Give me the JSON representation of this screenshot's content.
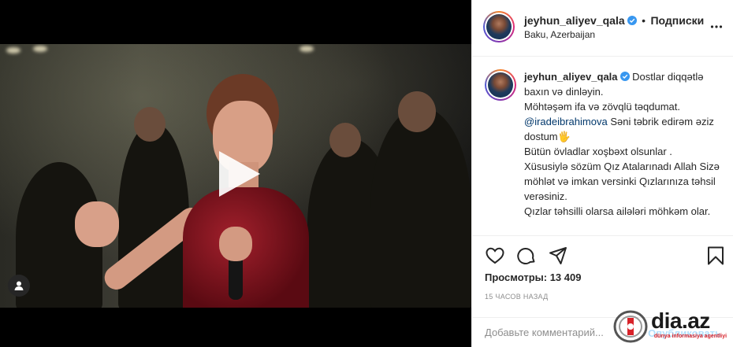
{
  "post": {
    "username": "jeyhun_aliyev_qala",
    "separator": "•",
    "follow_label": "Подписки",
    "location": "Baku, Azerbaijan"
  },
  "caption": {
    "username": "jeyhun_aliyev_qala",
    "line1": "Dostlar diqqətlə baxın və dinləyin.",
    "line2": "Möhtəşəm ifa və zövqlü təqdumat.",
    "mention": "@iradeibrahimova",
    "line3": "Səni təbrik edirəm əziz dostum🖐",
    "line4": "Bütün övladlar xoşbəxt olsunlar .",
    "line5": "Xüsusiylə sözüm Qız Atalarınadı Allah Sizə möhlət və imkan versinki Qızlarınıza təhsil verəsiniz.",
    "line6": "Qızlar təhsilli olarsa ailələri möhkəm olar."
  },
  "stats": {
    "views": "Просмотры: 13 409",
    "time": "15 ЧАСОВ НАЗАД"
  },
  "comment": {
    "placeholder": "Добавьте комментарий...",
    "publish_label": "Опубликовать"
  },
  "watermark": {
    "brand": "dia.az",
    "tagline": "dünya informasiya agentliyi"
  },
  "icons": {
    "like": "heart-icon",
    "comment": "comment-icon",
    "share": "share-icon",
    "save": "bookmark-icon",
    "more": "more-options-icon",
    "verified": "verified-badge-icon",
    "play": "play-icon",
    "user_tag": "user-tag-icon"
  },
  "colors": {
    "verified": "#3897f0",
    "mention": "#00376b",
    "publish_disabled": "#b2dffc",
    "muted": "#8e8e8e"
  }
}
